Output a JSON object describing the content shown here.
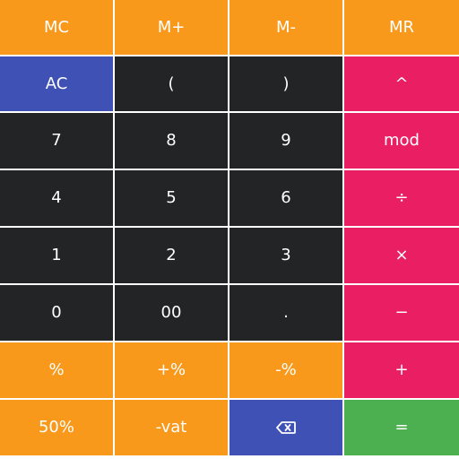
{
  "memory_row": {
    "mc": "MC",
    "m_plus": "M+",
    "m_minus": "M-",
    "mr": "MR"
  },
  "keys": {
    "ac": "AC",
    "open_paren": "(",
    "close_paren": ")",
    "power": "^",
    "seven": "7",
    "eight": "8",
    "nine": "9",
    "mod": "mod",
    "four": "4",
    "five": "5",
    "six": "6",
    "divide": "÷",
    "one": "1",
    "two": "2",
    "three": "3",
    "multiply": "×",
    "zero": "0",
    "double_zero": "00",
    "decimal": ".",
    "minus": "−",
    "percent": "%",
    "plus_percent": "+%",
    "minus_percent": "-%",
    "plus": "+",
    "fifty_percent": "50%",
    "minus_vat": "-vat",
    "backspace_icon": "backspace-icon",
    "equals": "="
  },
  "colors": {
    "memory_keys": "#f8991c",
    "digit_keys": "#232426",
    "clear_key": "#3f51b5",
    "operator_keys": "#e91e63",
    "equals_key": "#4caf50",
    "text": "#ffffff"
  }
}
